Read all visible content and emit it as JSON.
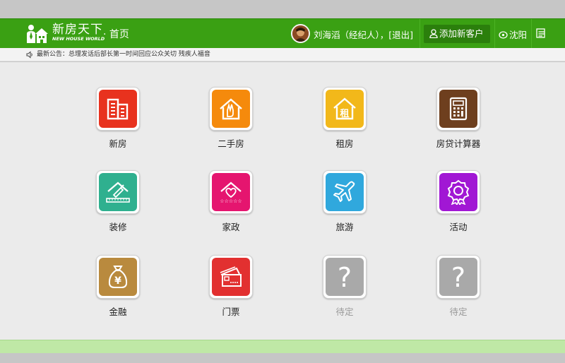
{
  "header": {
    "brand_name": "新房天下",
    "brand_en": "NEW HOUSE WORLD",
    "page_title": "首页",
    "user_text": "刘海滔（经纪人），",
    "logout_label": "[退出]",
    "add_customer_label": "添加新客户",
    "city_label": "沈阳"
  },
  "notice": {
    "prefix": "最新公告：",
    "text": "总理发话后部长第一时间回应公众关切 残疾人福音"
  },
  "tiles": [
    {
      "label": "新房",
      "color": "#e8321e",
      "icon": "building-icon"
    },
    {
      "label": "二手房",
      "color": "#f58a0c",
      "icon": "hand-house-icon"
    },
    {
      "label": "租房",
      "color": "#f2b81a",
      "icon": "rent-house-icon"
    },
    {
      "label": "房贷计算器",
      "color": "#6e3f1e",
      "icon": "calculator-icon"
    },
    {
      "label": "装修",
      "color": "#2fb08f",
      "icon": "renovation-icon"
    },
    {
      "label": "家政",
      "color": "#e5156f",
      "icon": "housekeeping-icon"
    },
    {
      "label": "旅游",
      "color": "#30a8dd",
      "icon": "airplane-icon"
    },
    {
      "label": "活动",
      "color": "#a117d4",
      "icon": "badge-icon"
    },
    {
      "label": "金融",
      "color": "#b98a3e",
      "icon": "money-bag-icon"
    },
    {
      "label": "门票",
      "color": "#e23030",
      "icon": "ticket-icon"
    },
    {
      "label": "待定",
      "color": "#a9a9a9",
      "icon": "question-icon"
    },
    {
      "label": "待定",
      "color": "#a9a9a9",
      "icon": "question-icon"
    }
  ],
  "colors": {
    "header_green": "#3aa013",
    "footer_green": "#bfe8a6",
    "content_bg": "#ebebeb"
  }
}
